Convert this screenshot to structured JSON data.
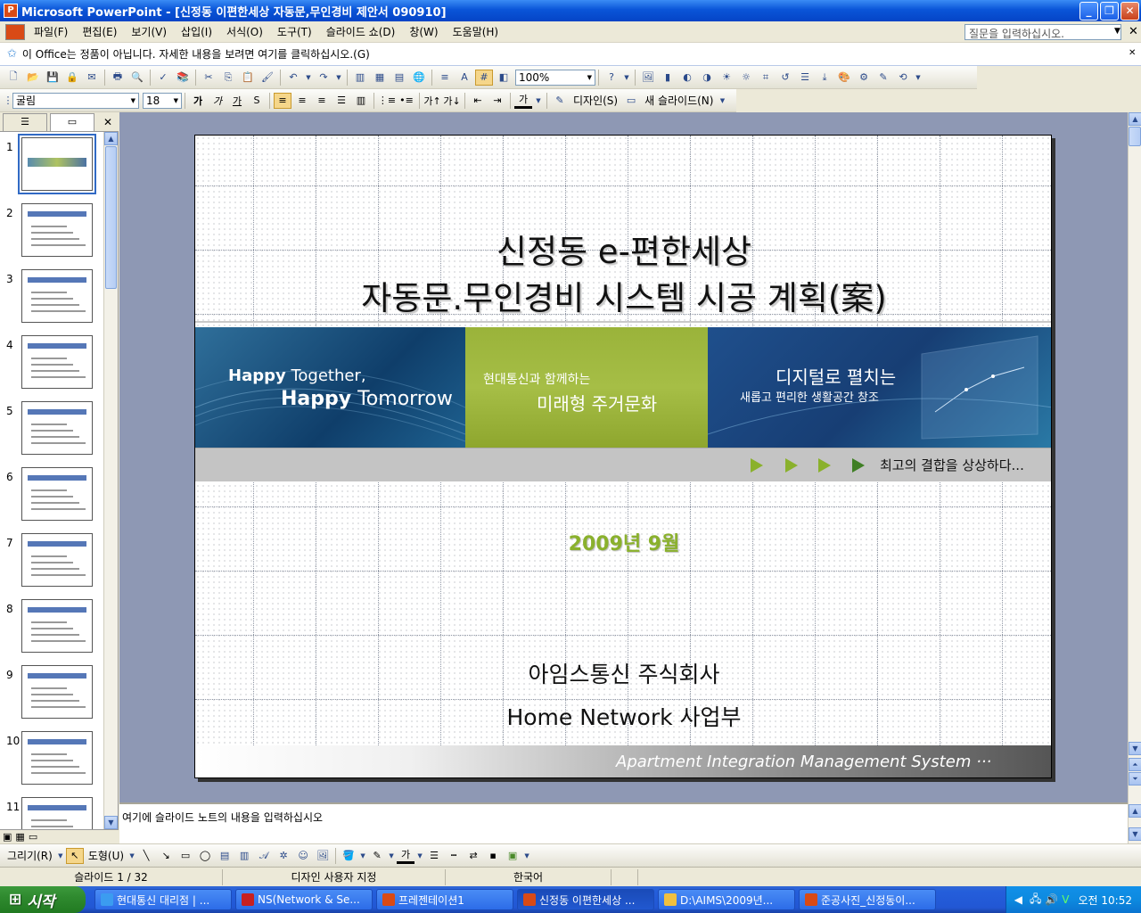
{
  "window": {
    "title": "Microsoft PowerPoint - [신정동 이편한세상 자동문,무인경비 제안서 090910]",
    "app_icon": "powerpoint-icon"
  },
  "menu": {
    "items": [
      "파일(F)",
      "편집(E)",
      "보기(V)",
      "삽입(I)",
      "서식(O)",
      "도구(T)",
      "슬라이드 쇼(D)",
      "창(W)",
      "도움말(H)"
    ],
    "help_placeholder": "질문을 입력하십시오."
  },
  "infobar": {
    "text": "이 Office는 정품이 아닙니다.  자세한 내용을 보려면 여기를 클릭하십시오.(G)"
  },
  "toolbar_standard": {
    "zoom": "100%"
  },
  "toolbar_format": {
    "font": "굴림",
    "size": "18",
    "design_label": "디자인(S)",
    "new_slide_label": "새 슬라이드(N)"
  },
  "slides_pane": {
    "numbers": [
      "1",
      "2",
      "3",
      "4",
      "5",
      "6",
      "7",
      "8",
      "9",
      "10",
      "11"
    ],
    "selected": "1"
  },
  "slide": {
    "title_line1": "신정동 e-편한세상",
    "title_line2": "자동문.무인경비 시스템 시공 계획(案)",
    "banner_left_1a": "Happy",
    "banner_left_1b": " Together,",
    "banner_left_2a": "Happy",
    "banner_left_2b": " Tomorrow",
    "banner_mid_1": "현대통신과 함께하는",
    "banner_mid_2": "미래형 주거문화",
    "banner_right_1": "디지털로 펼치는",
    "banner_right_2": "새롭고 편리한 생활공간 창조",
    "tagline": "최고의 결합을 상상하다...",
    "date": "2009년 9월",
    "company": "아임스통신 주식회사",
    "department": "Home Network 사업부",
    "footer": "Apartment Integration Management System ···"
  },
  "notes": {
    "placeholder": "여기에 슬라이드 노트의 내용을 입력하십시오"
  },
  "drawing_toolbar": {
    "draw_label": "그리기(R)",
    "shapes_label": "도형(U)"
  },
  "status": {
    "slide": "슬라이드 1 / 32",
    "design": "디자인 사용자 지정",
    "language": "한국어"
  },
  "taskbar": {
    "start": "시작",
    "items": [
      "현대통신 대리점 | ...",
      "NS(Network & Se...",
      "프레젠테이션1",
      "신정동 이편한세상 ...",
      "D:\\AIMS\\2009년...",
      "준공사진_신정동이..."
    ],
    "time": "오전 10:52"
  },
  "colors": {
    "accent_green": "#8ab12c",
    "titlebar_blue": "#0a55d8",
    "taskbar_blue": "#245edb"
  }
}
